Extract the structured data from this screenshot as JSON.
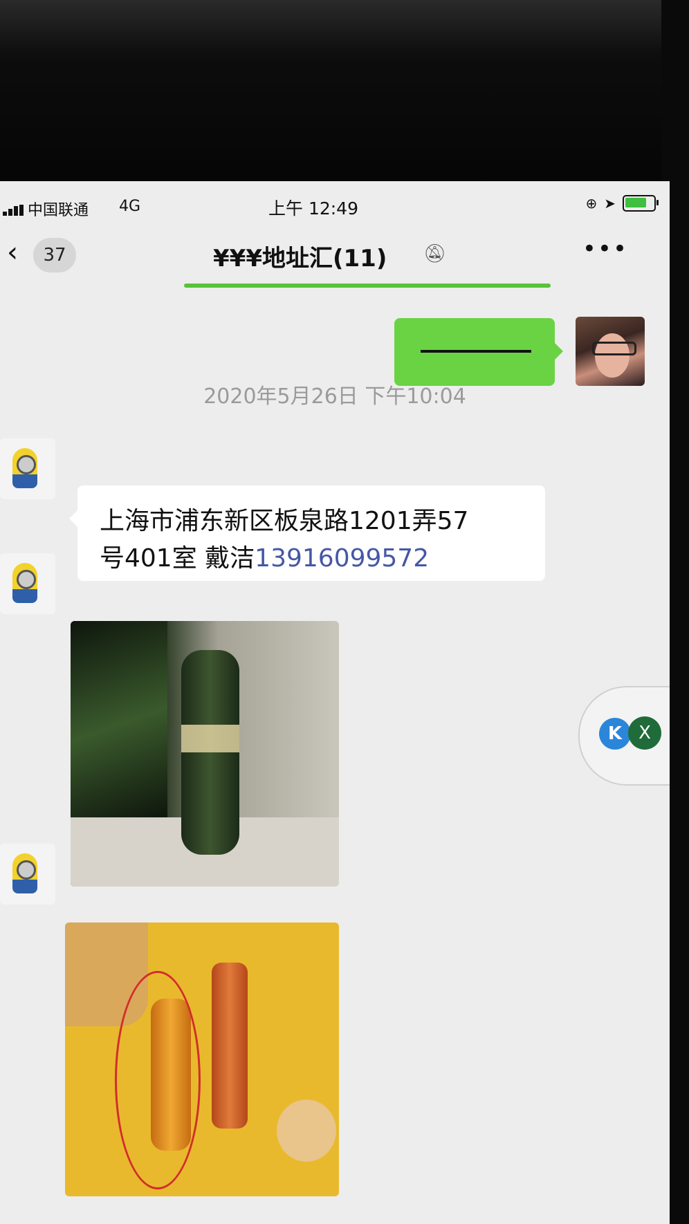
{
  "status_bar": {
    "carrier": "中国联通",
    "network": "4G",
    "time": "上午 12:49",
    "icons": [
      "orientation-lock-icon",
      "location-icon",
      "battery-charging-icon"
    ]
  },
  "nav": {
    "back_icon": "chevron-left-icon",
    "unread_count": "37",
    "title": "¥¥¥地址汇(11)",
    "mute_icon": "bell-slash-icon",
    "more_icon": "ellipsis-icon",
    "more_label": "•••"
  },
  "messages": {
    "timestamp": "2020年5月26日 下午10:04",
    "address_line1": "上海市浦东新区板泉路1201弄57",
    "address_line2_prefix": "号401室 戴洁",
    "address_phone": "13916099572"
  },
  "float_widget": {
    "app_label": "K",
    "close_label": "X"
  },
  "colors": {
    "sent_bubble": "#6ad344",
    "received_bubble": "#ffffff",
    "phone_link": "#4657a5",
    "chat_bg": "#ededed"
  }
}
